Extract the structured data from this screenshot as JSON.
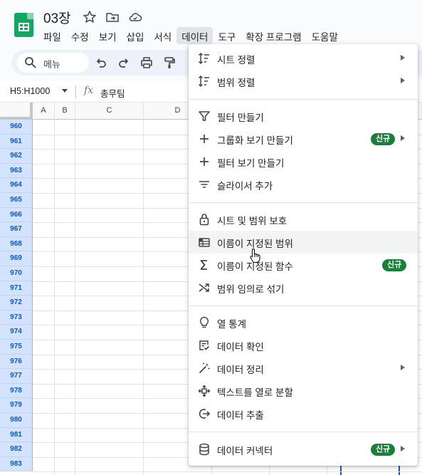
{
  "app": {
    "doc_title": "03장",
    "menus": [
      "파일",
      "수정",
      "보기",
      "삽입",
      "서식",
      "데이터",
      "도구",
      "확장 프로그램",
      "도움말"
    ],
    "active_menu_index": 5
  },
  "toolbar": {
    "search_label": "메뉴"
  },
  "formula_bar": {
    "name_box": "H5:H1000",
    "fx": "fx",
    "value": "총무팀"
  },
  "grid": {
    "columns": [
      "A",
      "B",
      "C",
      "D"
    ],
    "rows": [
      "960",
      "961",
      "962",
      "963",
      "964",
      "965",
      "966",
      "967",
      "968",
      "969",
      "970",
      "971",
      "972",
      "973",
      "974",
      "975",
      "976",
      "977",
      "978",
      "979",
      "980",
      "981",
      "982",
      "983"
    ]
  },
  "data_menu": {
    "groups": [
      [
        {
          "label": "시트 정렬",
          "icon": "sort-icon",
          "submenu": true
        },
        {
          "label": "범위 정렬",
          "icon": "sort-range-icon",
          "submenu": true
        }
      ],
      [
        {
          "label": "필터 만들기",
          "icon": "filter-icon"
        },
        {
          "label": "그룹화 보기 만들기",
          "icon": "plus-icon",
          "badge": "신규",
          "submenu": true
        },
        {
          "label": "필터 보기 만들기",
          "icon": "plus-icon"
        },
        {
          "label": "슬라이서 추가",
          "icon": "slicer-icon"
        }
      ],
      [
        {
          "label": "시트 및 범위 보호",
          "icon": "lock-icon"
        },
        {
          "label": "이름이 지정된 범위",
          "icon": "named-range-icon",
          "hover": true
        },
        {
          "label": "이름이 지정된 함수",
          "icon": "sigma-icon",
          "badge": "신규"
        },
        {
          "label": "범위 임의로 섞기",
          "icon": "shuffle-icon"
        }
      ],
      [
        {
          "label": "열 통계",
          "icon": "lightbulb-icon"
        },
        {
          "label": "데이터 확인",
          "icon": "validation-icon"
        },
        {
          "label": "데이터 정리",
          "icon": "magic-wand-icon",
          "submenu": true
        },
        {
          "label": "텍스트를 열로 분할",
          "icon": "split-icon"
        },
        {
          "label": "데이터 추출",
          "icon": "extract-icon"
        }
      ],
      [
        {
          "label": "데이터 커넥터",
          "icon": "database-icon",
          "badge": "신규",
          "submenu": true
        }
      ]
    ]
  },
  "colors": {
    "badge_green": "#188038",
    "row_header_selected": "#d3e3fd",
    "accent_blue": "#0b57d0"
  }
}
